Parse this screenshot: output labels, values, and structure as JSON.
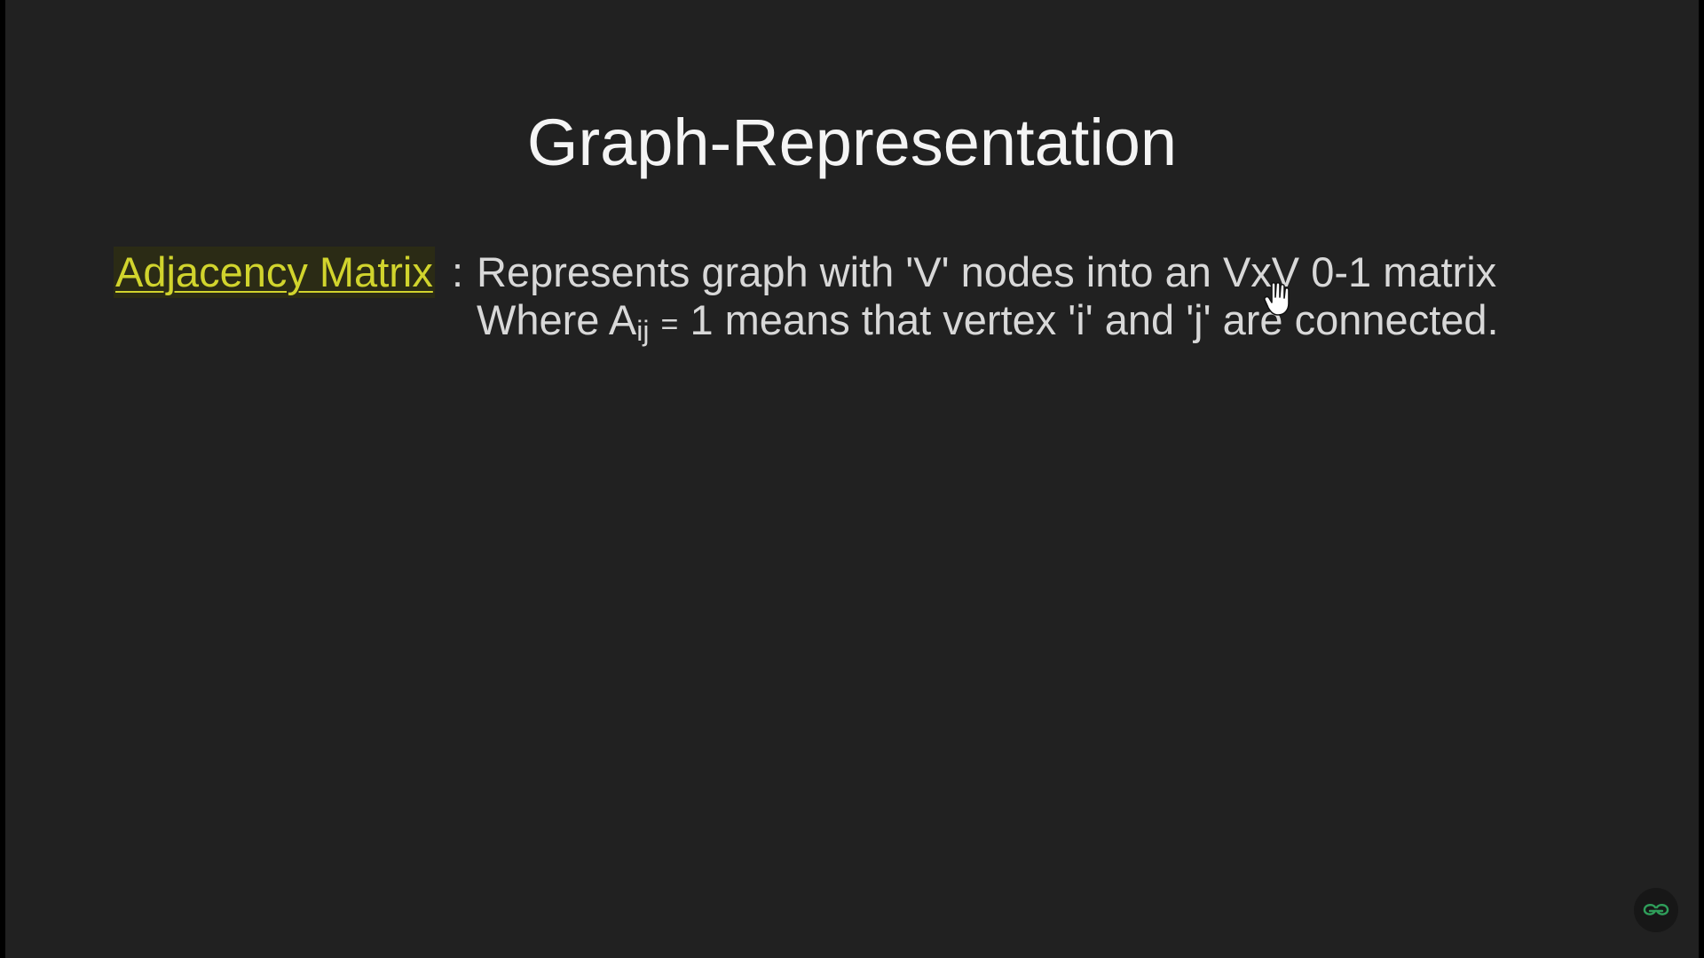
{
  "slide": {
    "title": "Graph-Representation",
    "term": "Adjacency Matrix",
    "separator": ":",
    "line1": "Represents graph with 'V' nodes into an VxV 0-1 matrix",
    "line2": {
      "prefix": "Where A",
      "subscript": "ij",
      "equals": "=",
      "suffix": "1 means that vertex 'i' and 'j' are connected."
    }
  },
  "colors": {
    "background": "#212121",
    "title": "#f4f4f4",
    "text": "#d8d8d8",
    "highlight": "#d1d42d",
    "logo": "#2f9e5a"
  },
  "icons": {
    "cursor": "hand-pointer-icon",
    "watermark": "geeksforgeeks-logo-icon"
  }
}
